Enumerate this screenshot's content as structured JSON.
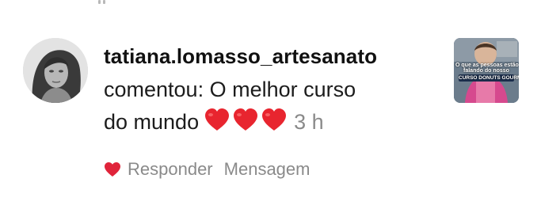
{
  "notification": {
    "username": "tatiana.lomasso_artesanato",
    "comment_line1": "comentou: O melhor curso",
    "comment_line2": "do mundo",
    "emoji": "❤️❤️❤️",
    "time": "3 h",
    "actions": {
      "reply_label": "Responder",
      "message_label": "Mensagem"
    },
    "like_icon": "heart-icon",
    "like_color": "#e0243a",
    "thumbnail": {
      "caption_line1": "O que as pessoas estão",
      "caption_line2": "falando do nosso",
      "caption_line3": "CURSO DONUTS GOURMET"
    }
  }
}
